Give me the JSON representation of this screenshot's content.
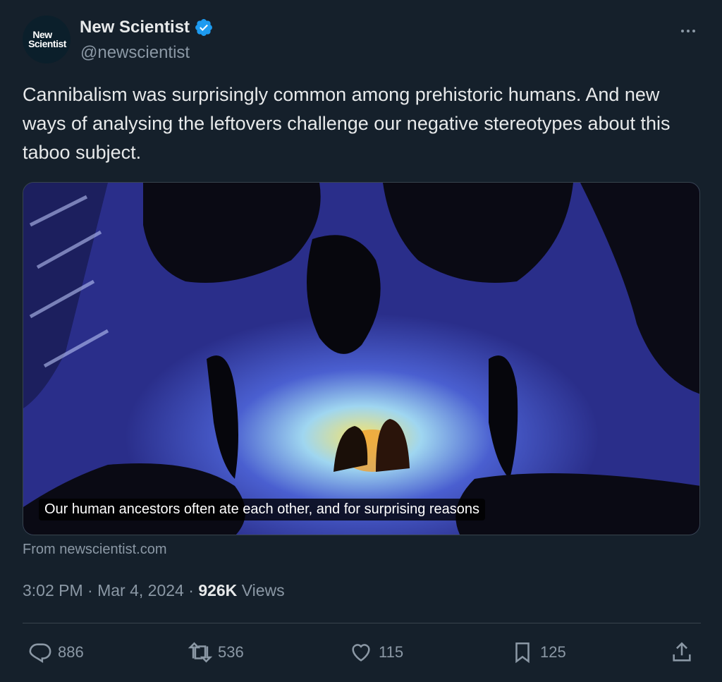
{
  "account": {
    "display_name": "New Scientist",
    "handle": "@newscientist",
    "avatar_line1": "New",
    "avatar_line2": "Scientist",
    "verified_icon": "verified-badge-icon",
    "verified_color": "#1d9bf0"
  },
  "tweet": {
    "text": "Cannibalism was surprisingly common among prehistoric humans. And new ways of analysing the leftovers challenge our negative stereotypes about this taboo subject."
  },
  "card": {
    "caption": "Our human ancestors often ate each other, and for surprising reasons",
    "source": "From newscientist.com"
  },
  "meta": {
    "time": "3:02 PM",
    "separator": "·",
    "date": "Mar 4, 2024",
    "views_count": "926K",
    "views_label": "Views"
  },
  "actions": {
    "replies": "886",
    "retweets": "536",
    "likes": "115",
    "bookmarks": "125"
  },
  "colors": {
    "background": "#15202b",
    "primary_text": "#e7e9ea",
    "secondary_text": "#8b98a5",
    "border": "#38444d"
  }
}
